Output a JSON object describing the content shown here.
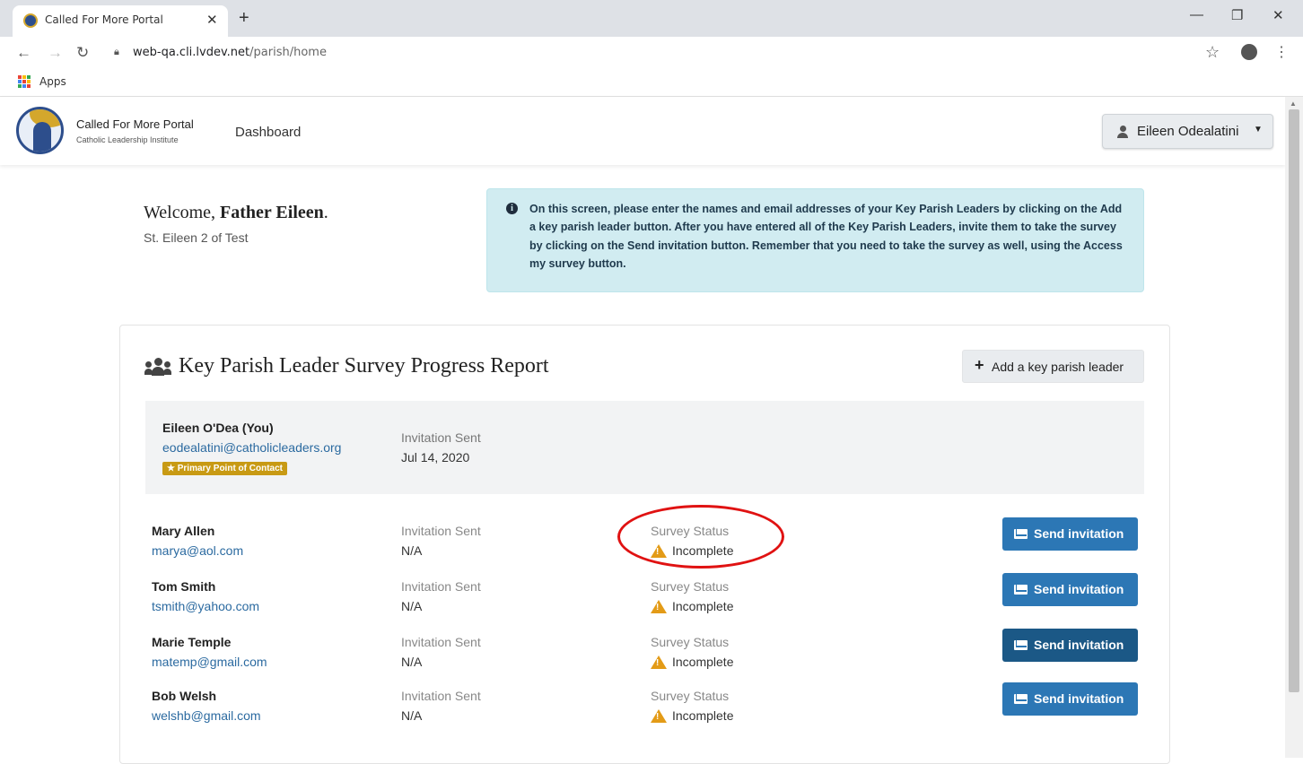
{
  "browser": {
    "tab_title": "Called For More Portal",
    "url_host": "web-qa.cli.lvdev.net",
    "url_path": "/parish/home",
    "bookmarks_apps_label": "Apps"
  },
  "navbar": {
    "brand_name": "Called For More Portal",
    "brand_sub": "Catholic Leadership Institute",
    "dashboard_link": "Dashboard",
    "user_name": "Eileen Odealatini"
  },
  "welcome": {
    "greeting": "Welcome, ",
    "name": "Father Eileen",
    "suffix": ".",
    "parish": "St. Eileen 2 of Test"
  },
  "info_message": "On this screen, please enter the names and email addresses of your Key Parish Leaders by clicking on the Add a key parish leader button. After you have entered all of the Key Parish Leaders, invite them to take the survey by clicking on the Send invitation button. Remember that you need to take the survey as well, using the Access my survey button.",
  "report": {
    "title": "Key Parish Leader Survey Progress Report",
    "add_button": "Add a key parish leader",
    "primary": {
      "name": "Eileen O'Dea (You)",
      "email": "eodealatini@catholicleaders.org",
      "badge": "Primary Point of Contact",
      "invitation_label": "Invitation Sent",
      "invitation_date": "Jul 14, 2020"
    },
    "leaders": [
      {
        "name": "Mary Allen",
        "email": "marya@aol.com",
        "invitation_label": "Invitation Sent",
        "invitation_value": "N/A",
        "status_label": "Survey Status",
        "status_value": "Incomplete",
        "button": "Send invitation"
      },
      {
        "name": "Tom Smith",
        "email": "tsmith@yahoo.com",
        "invitation_label": "Invitation Sent",
        "invitation_value": "N/A",
        "status_label": "Survey Status",
        "status_value": "Incomplete",
        "button": "Send invitation"
      },
      {
        "name": "Marie Temple",
        "email": "matemp@gmail.com",
        "invitation_label": "Invitation Sent",
        "invitation_value": "N/A",
        "status_label": "Survey Status",
        "status_value": "Incomplete",
        "button": "Send invitation"
      },
      {
        "name": "Bob Welsh",
        "email": "welshb@gmail.com",
        "invitation_label": "Invitation Sent",
        "invitation_value": "N/A",
        "status_label": "Survey Status",
        "status_value": "Incomplete",
        "button": "Send invitation"
      }
    ]
  },
  "colors": {
    "link": "#2b6aa0",
    "send_button": "#2c77b5",
    "info_bg": "#d1ecf1",
    "badge": "#c89a14",
    "warning": "#e39b17",
    "annotation": "#e01212"
  }
}
